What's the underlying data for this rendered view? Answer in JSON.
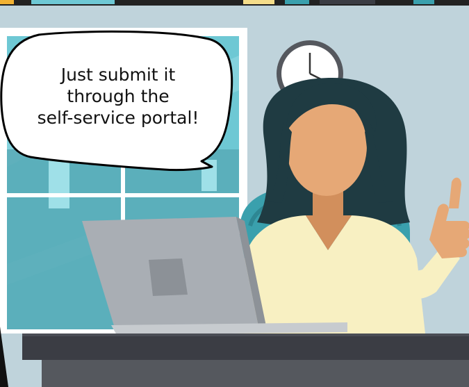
{
  "speech_bubble": {
    "lines": [
      "Just submit it",
      "through the",
      "self-service portal!"
    ]
  },
  "illustration": {
    "subject": "office worker giving a thumbs up at a laptop",
    "icons": [
      "speech-bubble",
      "wall-clock-icon",
      "laptop",
      "thumbs-up-hand-icon"
    ]
  },
  "colors": {
    "wall": "#bfd3db",
    "window_glass": "#6ec8d4",
    "hair": "#1f3b42",
    "skin": "#e6a876",
    "blouse": "#f8f0c2",
    "chair": "#3aa0ad",
    "laptop": "#a9aeb4",
    "desk": "#3b3d44"
  }
}
